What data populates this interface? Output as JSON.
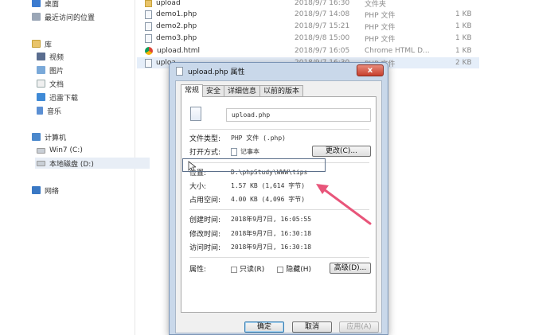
{
  "nav": {
    "desktop": "桌面",
    "recent": "最近访问的位置",
    "library": "库",
    "video": "视频",
    "pictures": "图片",
    "documents": "文档",
    "downloads": "迅雷下载",
    "music": "音乐",
    "computer": "计算机",
    "drive_c": "Win7 (C:)",
    "drive_d": "本地磁盘 (D:)",
    "network": "网络"
  },
  "files": [
    {
      "name": "upload",
      "date": "2018/9/7 16:30",
      "type": "文件夹",
      "size": ""
    },
    {
      "name": "demo1.php",
      "date": "2018/9/7 14:08",
      "type": "PHP 文件",
      "size": "1 KB"
    },
    {
      "name": "demo2.php",
      "date": "2018/9/7 15:21",
      "type": "PHP 文件",
      "size": "1 KB"
    },
    {
      "name": "demo3.php",
      "date": "2018/9/8 15:00",
      "type": "PHP 文件",
      "size": "1 KB"
    },
    {
      "name": "upload.html",
      "date": "2018/9/7 16:05",
      "type": "Chrome HTML D...",
      "size": "1 KB"
    },
    {
      "name": "uploa...",
      "date": "2018/9/7 16:30",
      "type": "PHP 文件",
      "size": "2 KB"
    }
  ],
  "dialog": {
    "title": "upload.php 属性",
    "close": "x",
    "tabs": [
      "常规",
      "安全",
      "详细信息",
      "以前的版本"
    ],
    "filename": "upload.php",
    "file_type_label": "文件类型:",
    "file_type_value": "PHP 文件 (.php)",
    "open_with_label": "打开方式:",
    "open_with_value": "记事本",
    "change_button": "更改(C)...",
    "location_label": "位置:",
    "location_value": "D:\\phpStudy\\WWW\\tips",
    "size_label": "大小:",
    "size_value": "1.57 KB (1,614 字节)",
    "disk_size_label": "占用空间:",
    "disk_size_value": "4.00 KB (4,096 字节)",
    "created_label": "创建时间:",
    "created_value": "2018年9月7日, 16:05:55",
    "modified_label": "修改时间:",
    "modified_value": "2018年9月7日, 16:30:18",
    "accessed_label": "访问时间:",
    "accessed_value": "2018年9月7日, 16:30:18",
    "attributes_label": "属性:",
    "readonly_label": "只读(R)",
    "hidden_label": "隐藏(H)",
    "advanced_button": "高级(D)...",
    "ok_button": "确定",
    "cancel_button": "取消",
    "apply_button": "应用(A)"
  },
  "colors": {
    "annotation_arrow": "#e8557a",
    "dialog_frame": "#c9d8ea"
  }
}
